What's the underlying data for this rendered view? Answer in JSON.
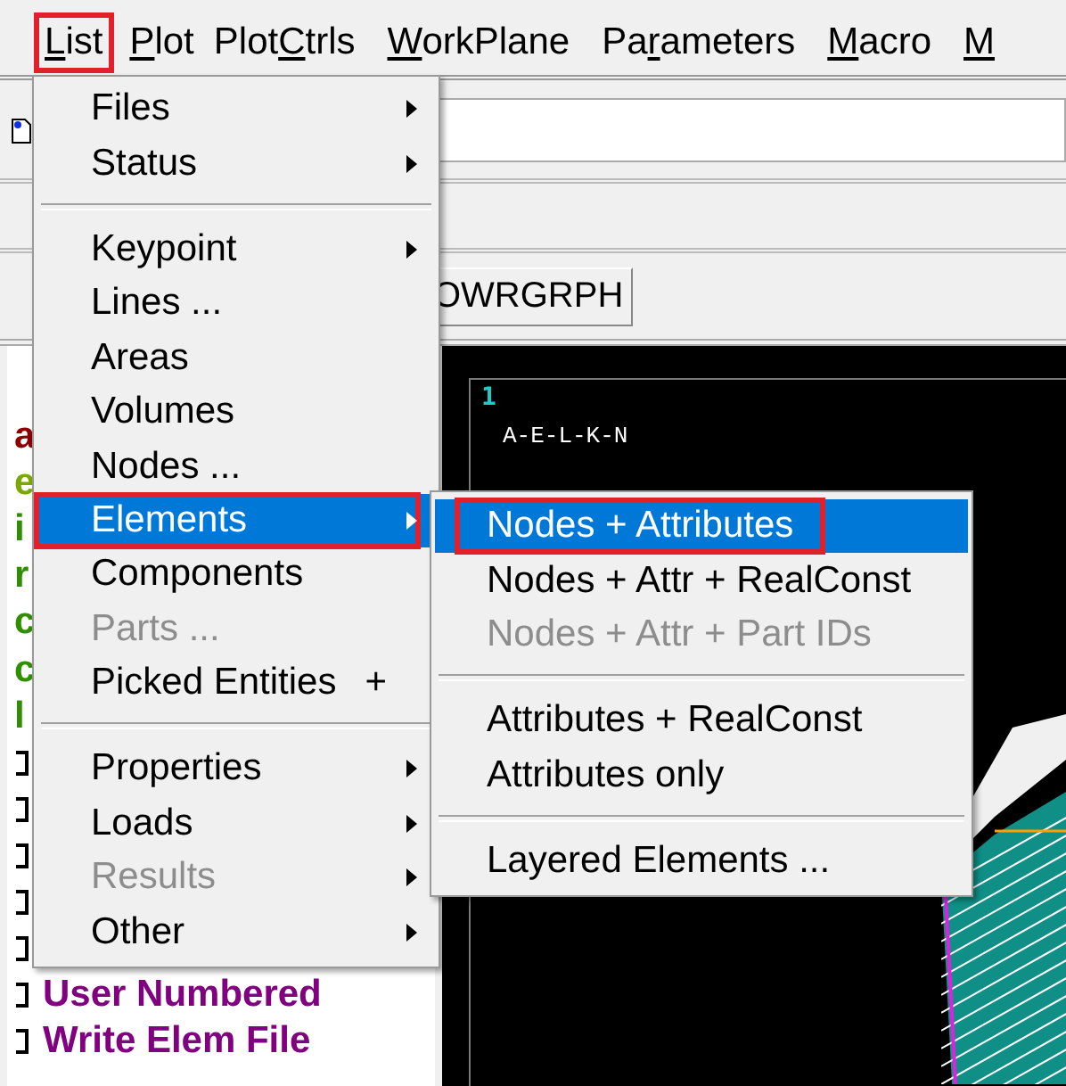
{
  "menubar": [
    {
      "mnemonic": "L",
      "after": "ist",
      "annotated": true
    },
    {
      "mnemonic": "P",
      "after": "lot",
      "annotated": false
    },
    {
      "before": "Plot",
      "mnemonic": "C",
      "after": "trls",
      "annotated": false
    },
    {
      "mnemonic": "W",
      "after": "orkPlane",
      "annotated": false
    },
    {
      "before": "Pa",
      "mnemonic": "r",
      "after": "ameters",
      "annotated": false
    },
    {
      "mnemonic": "M",
      "after": "acro",
      "annotated": false
    },
    {
      "mnemonic": "M",
      "annotated": false
    }
  ],
  "toolbar_button": "OWRGRPH",
  "tree": [
    {
      "kind": "text",
      "label": "a",
      "color": "#8b0000"
    },
    {
      "kind": "text",
      "label": "e",
      "color": "#7aa800"
    },
    {
      "kind": "text",
      "label": "i",
      "color": "#2f8f00"
    },
    {
      "kind": "text",
      "label": "r",
      "color": "#2f8f00"
    },
    {
      "kind": "text",
      "label": "c",
      "color": "#2f8f00"
    },
    {
      "kind": "text",
      "label": "c",
      "color": "#2f8f00"
    },
    {
      "kind": "text",
      "label": "l",
      "color": "#2f8f00"
    },
    {
      "kind": "icon"
    },
    {
      "kind": "icon"
    },
    {
      "kind": "icon"
    },
    {
      "kind": "icon"
    },
    {
      "kind": "icon"
    },
    {
      "kind": "item",
      "label": "User Numbered",
      "color": "#800080"
    },
    {
      "kind": "item",
      "label": "Write Elem File",
      "color": "#800080"
    }
  ],
  "graphics": {
    "window_number": "1",
    "label": "A-E-L-K-N"
  },
  "menu": {
    "sections": [
      [
        {
          "label": "Files",
          "submenu": true,
          "disabled": false,
          "selected": false,
          "annotated": false
        },
        {
          "label": "Status",
          "submenu": true,
          "disabled": false,
          "selected": false,
          "annotated": false
        }
      ],
      [
        {
          "label": "Keypoint",
          "submenu": true,
          "disabled": false,
          "selected": false,
          "annotated": false
        },
        {
          "label": "Lines ...",
          "submenu": false,
          "disabled": false,
          "selected": false,
          "annotated": false
        },
        {
          "label": "Areas",
          "submenu": false,
          "disabled": false,
          "selected": false,
          "annotated": false
        },
        {
          "label": "Volumes",
          "submenu": false,
          "disabled": false,
          "selected": false,
          "annotated": false
        },
        {
          "label": "Nodes ...",
          "submenu": false,
          "disabled": false,
          "selected": false,
          "annotated": false
        },
        {
          "label": "Elements",
          "submenu": true,
          "disabled": false,
          "selected": true,
          "annotated": true
        },
        {
          "label": "Components",
          "submenu": false,
          "disabled": false,
          "selected": false,
          "annotated": false
        },
        {
          "label": "Parts ...",
          "submenu": false,
          "disabled": true,
          "selected": false,
          "annotated": false
        },
        {
          "label": "Picked Entities",
          "shortcut": "+",
          "submenu": false,
          "disabled": false,
          "selected": false,
          "annotated": false
        }
      ],
      [
        {
          "label": "Properties",
          "submenu": true,
          "disabled": false,
          "selected": false,
          "annotated": false
        },
        {
          "label": "Loads",
          "submenu": true,
          "disabled": false,
          "selected": false,
          "annotated": false
        },
        {
          "label": "Results",
          "submenu": true,
          "disabled": true,
          "selected": false,
          "annotated": false
        },
        {
          "label": "Other",
          "submenu": true,
          "disabled": false,
          "selected": false,
          "annotated": false
        }
      ]
    ]
  },
  "submenu": {
    "sections": [
      [
        {
          "label": "Nodes + Attributes",
          "submenu": false,
          "disabled": false,
          "selected": true,
          "annotated": true
        },
        {
          "label": "Nodes + Attr + RealConst",
          "submenu": false,
          "disabled": false,
          "selected": false,
          "annotated": false
        },
        {
          "label": "Nodes + Attr + Part IDs",
          "submenu": false,
          "disabled": true,
          "selected": false,
          "annotated": false
        }
      ],
      [
        {
          "label": "Attributes + RealConst",
          "submenu": false,
          "disabled": false,
          "selected": false,
          "annotated": false
        },
        {
          "label": "Attributes only",
          "submenu": false,
          "disabled": false,
          "selected": false,
          "annotated": false
        }
      ],
      [
        {
          "label": "Layered Elements ...",
          "submenu": false,
          "disabled": false,
          "selected": false,
          "annotated": false
        }
      ]
    ]
  }
}
